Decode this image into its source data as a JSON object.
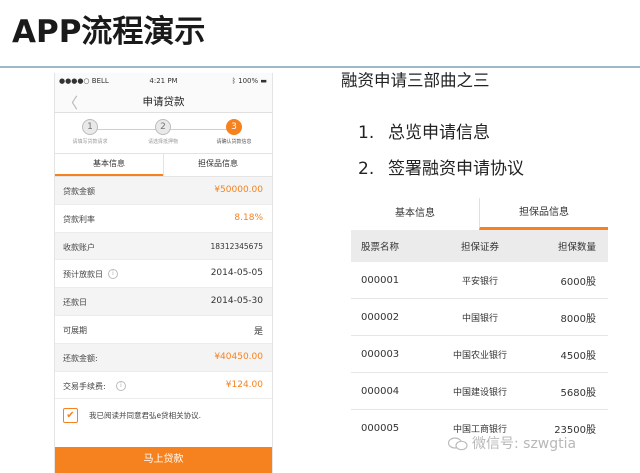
{
  "slide": {
    "title": "APP流程演示",
    "heading": "融资申请三部曲之三",
    "steps": [
      {
        "num": "1.",
        "label": "总览申请信息"
      },
      {
        "num": "2.",
        "label": "签署融资申请协议"
      }
    ]
  },
  "phone": {
    "status": {
      "carrier": "●●●●○ BELL",
      "time": "4:21 PM",
      "battery": "100%"
    },
    "nav": {
      "back": "〈",
      "title": "申请贷款"
    },
    "progress": [
      {
        "num": "1",
        "label": "请填写贷款请求",
        "active": false
      },
      {
        "num": "2",
        "label": "请选择抵押物",
        "active": false
      },
      {
        "num": "3",
        "label": "请确认贷款信息",
        "active": true
      }
    ],
    "tabs": [
      {
        "label": "基本信息",
        "active": true
      },
      {
        "label": "担保品信息",
        "active": false
      }
    ],
    "rows": [
      {
        "label": "贷款金额",
        "value": "¥50000.00",
        "orange": true,
        "info": false
      },
      {
        "label": "贷款利率",
        "value": "8.18%",
        "orange": true,
        "info": false
      },
      {
        "label": "收款账户",
        "value": "18312345675",
        "orange": false,
        "info": false
      },
      {
        "label": "预计放款日",
        "value": "2014-05-05",
        "orange": false,
        "info": true
      },
      {
        "label": "还款日",
        "value": "2014-05-30",
        "orange": false,
        "info": false
      },
      {
        "label": "可展期",
        "value": "是",
        "orange": false,
        "info": false
      },
      {
        "label": "还款金额:",
        "value": "¥40450.00",
        "orange": true,
        "info": false
      },
      {
        "label": "交易手续费:",
        "value": "¥124.00",
        "orange": true,
        "info": true
      }
    ],
    "agree": {
      "checkmark": "✔",
      "text": "我已阅读并同意君弘e贷相关协议."
    },
    "submit": "马上贷款"
  },
  "table": {
    "tabs": [
      {
        "label": "基本信息",
        "active": false
      },
      {
        "label": "担保品信息",
        "active": true
      }
    ],
    "headers": [
      "股票名称",
      "担保证券",
      "担保数量"
    ],
    "rows": [
      [
        "000001",
        "平安银行",
        "6000股"
      ],
      [
        "000002",
        "中国银行",
        "8000股"
      ],
      [
        "000003",
        "中国农业银行",
        "4500股"
      ],
      [
        "000004",
        "中国建设银行",
        "5680股"
      ],
      [
        "000005",
        "中国工商银行",
        "23500股"
      ]
    ]
  },
  "watermark": {
    "text": "微信号: szwgtia",
    "icon": "wechat-icon"
  },
  "colors": {
    "accent": "#f6821f",
    "rule": "#9fb8c6",
    "table_header": "#ebebeb"
  }
}
